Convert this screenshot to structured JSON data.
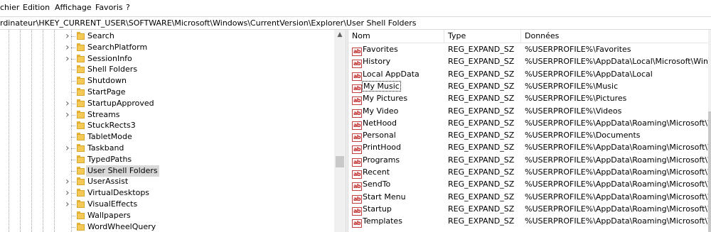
{
  "menu": {
    "items": [
      "chier",
      "Edition",
      "Affichage",
      "Favoris",
      "?"
    ]
  },
  "address": {
    "path": "rdinateur\\HKEY_CURRENT_USER\\SOFTWARE\\Microsoft\\Windows\\CurrentVersion\\Explorer\\User Shell Folders"
  },
  "tree": {
    "items": [
      {
        "label": "Search",
        "expandable": true
      },
      {
        "label": "SearchPlatform",
        "expandable": true
      },
      {
        "label": "SessionInfo",
        "expandable": true
      },
      {
        "label": "Shell Folders",
        "expandable": false
      },
      {
        "label": "Shutdown",
        "expandable": false
      },
      {
        "label": "StartPage",
        "expandable": false
      },
      {
        "label": "StartupApproved",
        "expandable": true
      },
      {
        "label": "Streams",
        "expandable": true
      },
      {
        "label": "StuckRects3",
        "expandable": false
      },
      {
        "label": "TabletMode",
        "expandable": false
      },
      {
        "label": "Taskband",
        "expandable": true
      },
      {
        "label": "TypedPaths",
        "expandable": false
      },
      {
        "label": "User Shell Folders",
        "expandable": false,
        "selected": true
      },
      {
        "label": "UserAssist",
        "expandable": true
      },
      {
        "label": "VirtualDesktops",
        "expandable": true
      },
      {
        "label": "VisualEffects",
        "expandable": true
      },
      {
        "label": "Wallpapers",
        "expandable": false
      },
      {
        "label": "WordWheelQuery",
        "expandable": false
      }
    ]
  },
  "list": {
    "headers": {
      "name": "Nom",
      "type": "Type",
      "data": "Données"
    },
    "value_icon": "ab",
    "rows": [
      {
        "name": "Favorites",
        "type": "REG_EXPAND_SZ",
        "data": "%USERPROFILE%\\Favorites"
      },
      {
        "name": "History",
        "type": "REG_EXPAND_SZ",
        "data": "%USERPROFILE%\\AppData\\Local\\Microsoft\\Windo..."
      },
      {
        "name": "Local AppData",
        "type": "REG_EXPAND_SZ",
        "data": "%USERPROFILE%\\AppData\\Local"
      },
      {
        "name": "My Music",
        "type": "REG_EXPAND_SZ",
        "data": "%USERPROFILE%\\Music",
        "focused": true
      },
      {
        "name": "My Pictures",
        "type": "REG_EXPAND_SZ",
        "data": "%USERPROFILE%\\Pictures"
      },
      {
        "name": "My Video",
        "type": "REG_EXPAND_SZ",
        "data": "%USERPROFILE%\\Videos"
      },
      {
        "name": "NetHood",
        "type": "REG_EXPAND_SZ",
        "data": "%USERPROFILE%\\AppData\\Roaming\\Microsoft\\Wi..."
      },
      {
        "name": "Personal",
        "type": "REG_EXPAND_SZ",
        "data": "%USERPROFILE%\\Documents"
      },
      {
        "name": "PrintHood",
        "type": "REG_EXPAND_SZ",
        "data": "%USERPROFILE%\\AppData\\Roaming\\Microsoft\\Wi..."
      },
      {
        "name": "Programs",
        "type": "REG_EXPAND_SZ",
        "data": "%USERPROFILE%\\AppData\\Roaming\\Microsoft\\Wi..."
      },
      {
        "name": "Recent",
        "type": "REG_EXPAND_SZ",
        "data": "%USERPROFILE%\\AppData\\Roaming\\Microsoft\\Wi..."
      },
      {
        "name": "SendTo",
        "type": "REG_EXPAND_SZ",
        "data": "%USERPROFILE%\\AppData\\Roaming\\Microsoft\\Wi..."
      },
      {
        "name": "Start Menu",
        "type": "REG_EXPAND_SZ",
        "data": "%USERPROFILE%\\AppData\\Roaming\\Microsoft\\Wi..."
      },
      {
        "name": "Startup",
        "type": "REG_EXPAND_SZ",
        "data": "%USERPROFILE%\\AppData\\Roaming\\Microsoft\\Wi..."
      },
      {
        "name": "Templates",
        "type": "REG_EXPAND_SZ",
        "data": "%USERPROFILE%\\AppData\\Roaming\\Microsoft\\Wi..."
      }
    ]
  },
  "icons": {
    "expand": "chevron-right-icon",
    "folder": "folder-icon",
    "value": "string-value-icon",
    "scroll_up": "scroll-up-arrow-icon"
  },
  "colors": {
    "selection": "#d9d9d9",
    "folder": "#f4c955",
    "value_icon": "#c02020"
  }
}
